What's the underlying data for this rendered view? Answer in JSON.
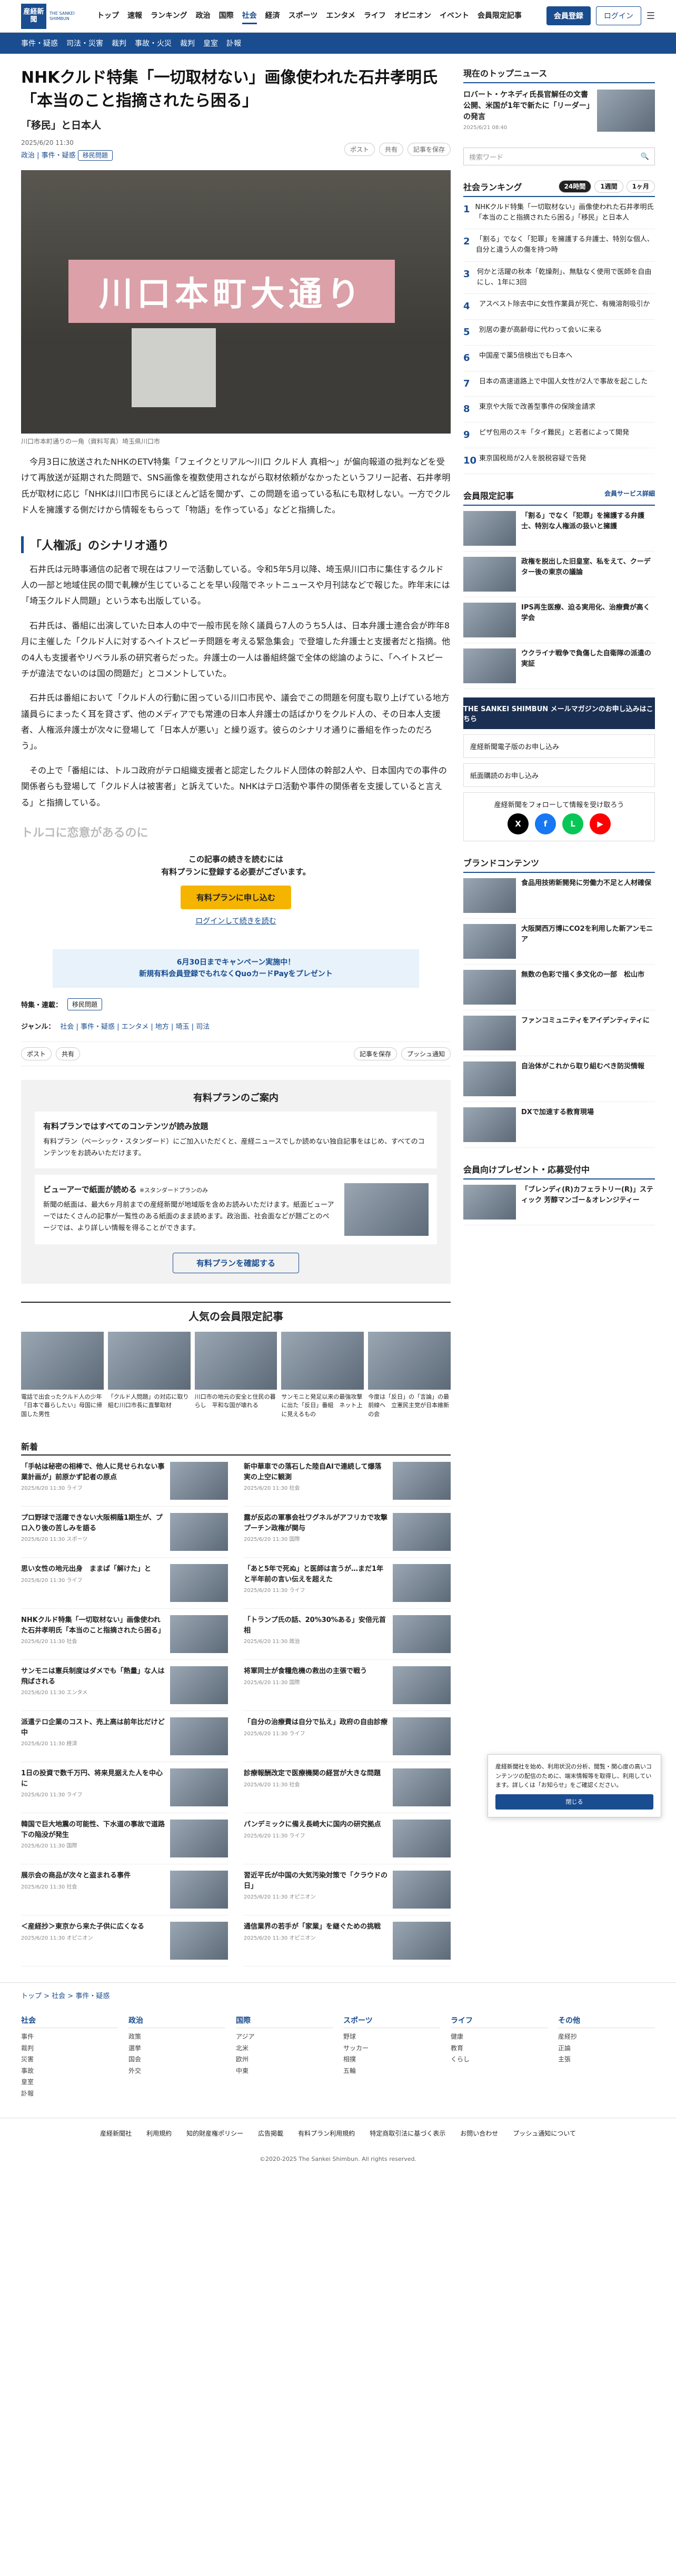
{
  "header": {
    "logo": "産経新聞",
    "logo_en": "THE SANKEI SHIMBUN",
    "nav": [
      "トップ",
      "速報",
      "ランキング",
      "政治",
      "国際",
      "社会",
      "経済",
      "スポーツ",
      "エンタメ",
      "ライフ",
      "オピニオン",
      "イベント",
      "会員限定記事"
    ],
    "active_nav": "社会",
    "member_btn": "会員登録",
    "login_btn": "ログイン",
    "menu_label": "メニュー"
  },
  "subnav": [
    "事件・疑惑",
    "司法・災害",
    "裁判",
    "事故・火災",
    "裁判",
    "皇室",
    "訃報"
  ],
  "article": {
    "title": "NHKクルド特集「一切取材ない」画像使われた石井孝明氏「本当のこと指摘されたら困る」",
    "subtitle": "「移民」と日本人",
    "date": "2025/6/20 11:30",
    "author": "産経新聞",
    "tags": [
      "政治",
      "事件・疑惑"
    ],
    "tag_badge": "移民問題",
    "share": [
      "ポスト",
      "共有"
    ],
    "bookmark": "記事を保存",
    "caption": "川口市本町通りの一角（資料写真）埼玉県川口市",
    "sign": "川口本町大通り",
    "paragraphs": [
      "今月3日に放送されたNHKのETV特集「フェイクとリアル〜川口 クルド人 真相〜」が偏向報道の批判などを受けて再放送が延期された問題で、SNS画像を複数使用されながら取材依頼がなかったというフリー記者、石井孝明氏が取材に応じ「NHKは川口市民らにほとんど話を聞かず、この問題を追っている私にも取材しない。一方でクルド人を擁護する側だけから情報をもらって「物語」を作っている」などと指摘した。"
    ],
    "h2": "「人権派」のシナリオ通り",
    "paragraphs2": [
      "石井氏は元時事通信の記者で現在はフリーで活動している。令和5年5月以降、埼玉県川口市に集住するクルド人の一部と地域住民の間で軋轢が生じていることを早い段階でネットニュースや月刊誌などで報じた。昨年末には「埼玉クルド人問題」という本も出版している。",
      "石井氏は、番組に出演していた日本人の中で一般市民を除く議員ら7人のうち5人は、日本弁護士連合会が昨年8月に主催した「クルド人に対するヘイトスピーチ問題を考える緊急集会」で登壇した弁護士と支援者だと指摘。他の4人も支援者やリベラル系の研究者らだった。弁護士の一人は番組終盤で全体の総論のように、「ヘイトスピーチが違法でないのは国の問題だ」とコメントしていた。",
      "石井氏は番組において「クルド人の行動に困っている川口市民や、議会でこの問題を何度も取り上げている地方議員らにまったく耳を貸さず、他のメディアでも常連の日本人弁護士の話ばかりをクルド人の、その日本人支援者、人権派弁護士が次々に登場して「日本人が悪い」と繰り返す。彼らのシナリオ通りに番組を作ったのだろう」。",
      "その上で「番組には、トルコ政府がテロ組織支援者と認定したクルド人団体の幹部2人や、日本国内での事件の関係者らも登場して「クルド人は被害者」と訴えていた。NHKはテロ活動や事件の関係者を支援していると言える」と指摘している。"
    ],
    "fade_h": "トルコに恋意があるのに"
  },
  "paywall": {
    "text1": "この記事の続きを読むには",
    "text2": "有料プランに登録する必要がございます。",
    "btn": "有料プランに申し込む",
    "login": "ログインして続きを読む",
    "promo1": "6月30日までキャンペーン実施中！",
    "promo2": "新規有料会員登録でもれなくQuoカードPayをプレゼント"
  },
  "kv": {
    "label1": "特集・連載：",
    "badge": "移民問題",
    "label2": "ジャンル：",
    "genres": "社会 | 事件・疑惑 | エンタメ | 地方 | 埼玉 | 司法"
  },
  "article_bar": {
    "share": [
      "ポスト",
      "共有"
    ],
    "save": "記事を保存",
    "push": "プッシュ通知"
  },
  "plan": {
    "title": "有料プランのご案内",
    "h1": "有料プランではすべてのコンテンツが読み放題",
    "t1": "有料プラン（ベーシック・スタンダード）にご加入いただくと、産経ニュースでしか読めない独自記事をはじめ、すべてのコンテンツをお読みいただけます。",
    "h2": "ビューアーで紙面が読める",
    "h2b": "※スタンダードプランのみ",
    "t2": "新聞の紙面は、最大6ヶ月前までの産経新聞が地域版を含めお読みいただけます。紙面ビューアーではたくさんの記事が一覧性のある紙面のまま読めます。政治面、社会面などが題ごとのページでは、より詳しい情報を得ることができます。",
    "btn": "有料プランを確認する"
  },
  "popular": {
    "title": "人気の会員限定記事",
    "items": [
      "電話で出会ったクルド人の少年　「日本で暮らしたい」母国に帰国した男性",
      "「クルド人問題」の対応に取り組む川口市長に直撃取材",
      "川口市の地元の安全と住民の暮らし　平和な国が壊れる",
      "サンモニと発足以来の最強攻撃に出た「反日」番組　ネット上に見えるもの",
      "今度は「反日」の「言論」の最前線へ　立憲民主党が日本維新の会"
    ]
  },
  "news": {
    "title": "新着",
    "items": [
      [
        "「手帖は秘密の相棒で、他人に見せられない事業計画が」前原かず記者の原点",
        "2025/6/20 11:30",
        "ライフ"
      ],
      [
        "新中華車での落石した陸自AIで連続して爆落実の上空に観測",
        "2025/6/20 11:30",
        "社会"
      ],
      [
        "プロ野球で活躍できない大阪桐蔭1期生が、プロ入り後の苦しみを語る",
        "2025/6/20 11:30",
        "スポーツ"
      ],
      [
        "露が反応の軍事会社ワグネルがアフリカで攻撃 プーチン政権が関与",
        "2025/6/20 11:30",
        "国際"
      ],
      [
        "思い女性の地元出身　ままば「解けた」と",
        "2025/6/20 11:30",
        "ライフ"
      ],
      [
        "「あと5年で死ぬ」と医師は言うが…まだ1年と半年前の言い伝えを超えた",
        "2025/6/20 11:30",
        "ライフ"
      ],
      [
        "NHKクルド特集「一切取材ない」画像使われた石井孝明氏「本当のこと指摘されたら困る」",
        "2025/6/20 11:30",
        "社会"
      ],
      [
        "「トランプ氏の話、20%30%ある」安倍元首相",
        "2025/6/20 11:30",
        "政治"
      ],
      [
        "サンモニは憲兵制度はダメでも「熱量」な人は飛ばされる",
        "2025/6/20 11:30",
        "エンタメ"
      ],
      [
        "将軍同士が食糧危機の救出の主張で戦う",
        "2025/6/20 11:30",
        "国際"
      ],
      [
        "派遣テロ企業のコスト、売上高は前年比だけど中",
        "2025/6/20 11:30",
        "経済"
      ],
      [
        "「自分の治療費は自分で払え」政府の自由診療",
        "2025/6/20 11:30",
        "ライフ"
      ],
      [
        "1日の投資で数千万円、将来見据えた人を中心に",
        "2025/6/20 11:30",
        "ライフ"
      ],
      [
        "診療報酬改定で医療機関の経営が大きな問題",
        "2025/6/20 11:30",
        "社会"
      ],
      [
        "韓国で巨大地震の可能性、下水道の事故で道路下の陥没が発生",
        "2025/6/20 11:30",
        "国際"
      ],
      [
        "パンデミックに備え長崎大に国内の研究拠点",
        "2025/6/20 11:30",
        "ライフ"
      ],
      [
        "展示会の商品が次々と盗まれる事件",
        "2025/6/20 11:30",
        "社会"
      ],
      [
        "習近平氏が中国の大気汚染対策で「クラウドの日」",
        "2025/6/20 11:30",
        "オピニオン"
      ],
      [
        "＜産経抄＞東京から来た子供に広くなる",
        "2025/6/20 11:30",
        "オピニオン"
      ],
      [
        "通信業界の若手が「家業」を継ぐための挑戦",
        "2025/6/20 11:30",
        "オピニオン"
      ]
    ]
  },
  "side": {
    "topnews_title": "現在のトップニュース",
    "topnews": "ロバート・ケネディ氏長官解任の文書公開、米国が1年で新たに「リーダー」の発言",
    "topnews_date": "2025/6/21 08:40",
    "search_placeholder": "検索ワード",
    "ranking_title": "社会ランキング",
    "rank_tabs": [
      "24時間",
      "1週間",
      "1ヶ月"
    ],
    "ranking": [
      "NHKクルド特集「一切取材ない」画像使われた石井孝明氏「本当のこと指摘されたら困る」「移民」と日本人",
      "「割る」でなく「犯罪」を擁護する弁護士、特別な個人、自分と違う人の傷を持つ時",
      "何かと活躍の秋本「乾燥剤」、無駄なく使用で医師を自由にし、1年に3回",
      "アスベスト除去中に女性作業員が死亡、有機溶剤吸引か",
      "別居の妻が高齢母に代わって会いに来る",
      "中国産で薬5倍検出でも日本へ",
      "日本の高速道路上で中国人女性が2人で事故を起こした",
      "東京や大阪で改善型事件の保険金請求",
      "ピザ包用のスキ「タイ難民」と若者によって開発",
      "東京国税局が2人を脱税容疑で告発"
    ],
    "members_title": "会員限定記事",
    "members_more": "会員サービス詳細",
    "members": [
      "「割る」でなく「犯罪」を擁護する弁護士、特別な人権派の扱いと擁護",
      "政権を脱出した旧皇室、私をえて、クーデター後の東京の議論",
      "IPS再生医療、迫る実用化、治療費が高く学会",
      "ウクライナ戦争で負傷した自衛隊の派遣の実証"
    ],
    "banner": "THE SANKEI SHIMBUN メールマガジンのお申し込みはこちら",
    "mail1": "産経新聞電子版のお申し込み",
    "mail2": "紙面購読のお申し込み",
    "follow": "産経新聞をフォローして情報を受け取ろう",
    "brand_title": "ブランドコンテンツ",
    "brand": [
      "食品用技術新開発に労働力不足と人材確保",
      "大阪関西万博にCO2を利用した新アンモニア",
      "無数の色彩で描く多文化の一部　松山市",
      "ファンコミュニティをアイデンティティに",
      "自治体がこれから取り組むべき防災情報",
      "DXで加速する教育現場"
    ],
    "present_title": "会員向けプレゼント・応募受付中",
    "present": "「ブレンディ(R)カフェラトリー(R)」スティック 芳醇マンゴー＆オレンジティー"
  },
  "footer": {
    "breadcrumb": "トップ > 社会 > 事件・疑惑",
    "cols": [
      {
        "h": "社会",
        "items": [
          "事件",
          "裁判",
          "災害",
          "事故",
          "皇室",
          "訃報"
        ]
      },
      {
        "h": "政治",
        "items": [
          "政策",
          "選挙",
          "国会",
          "外交"
        ]
      },
      {
        "h": "国際",
        "items": [
          "アジア",
          "北米",
          "欧州",
          "中東"
        ]
      },
      {
        "h": "スポーツ",
        "items": [
          "野球",
          "サッカー",
          "相撲",
          "五輪"
        ]
      },
      {
        "h": "ライフ",
        "items": [
          "健康",
          "教育",
          "くらし"
        ]
      },
      {
        "h": "その他",
        "items": [
          "産経抄",
          "正論",
          "主張"
        ]
      }
    ],
    "links": [
      "産経新聞社",
      "利用規約",
      "知的財産権ポリシー",
      "広告掲載",
      "有料プラン利用規約",
      "特定商取引法に基づく表示",
      "お問い合わせ",
      "プッシュ通知について"
    ],
    "copyright": "©2020-2025 The Sankei Shimbun. All rights reserved."
  },
  "cookie": {
    "text": "産経新聞社を始め、利用状況の分析、閲覧・関心度の高いコンテンツの配信のために、端末情報等を取得し、利用しています。詳しくは「お知らせ」をご確認ください。",
    "btn": "閉じる"
  }
}
